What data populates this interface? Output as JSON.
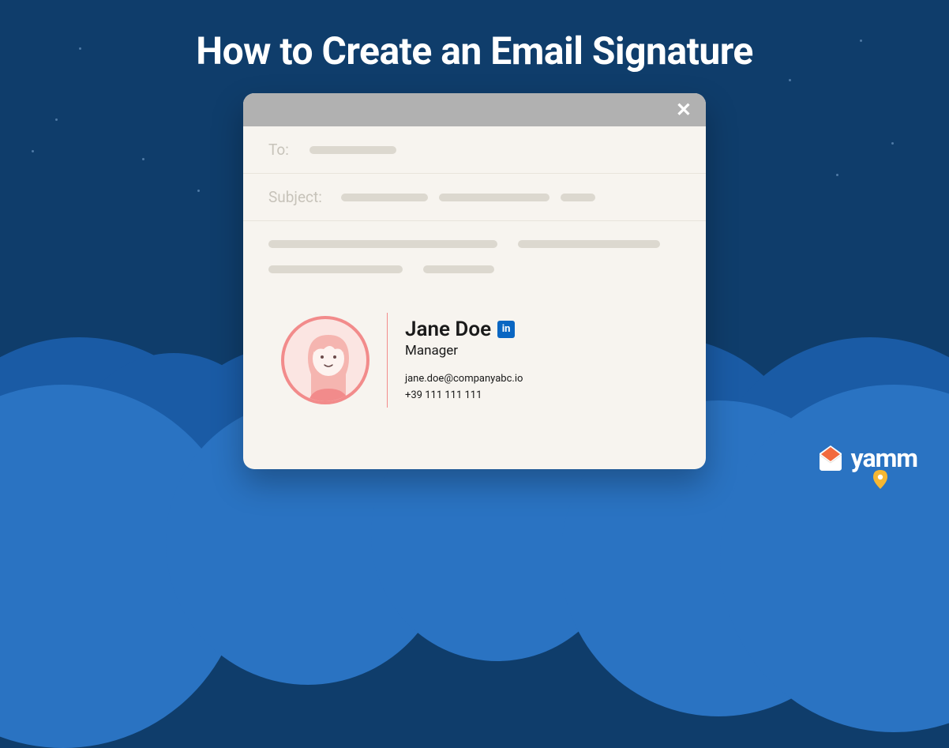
{
  "title": "How to Create an Email Signature",
  "email": {
    "to_label": "To:",
    "subject_label": "Subject:"
  },
  "signature": {
    "name": "Jane Doe",
    "role": "Manager",
    "email": "jane.doe@companyabc.io",
    "phone": "+39 111 111 111",
    "linkedin_label": "in"
  },
  "brand": {
    "name": "yamm"
  }
}
